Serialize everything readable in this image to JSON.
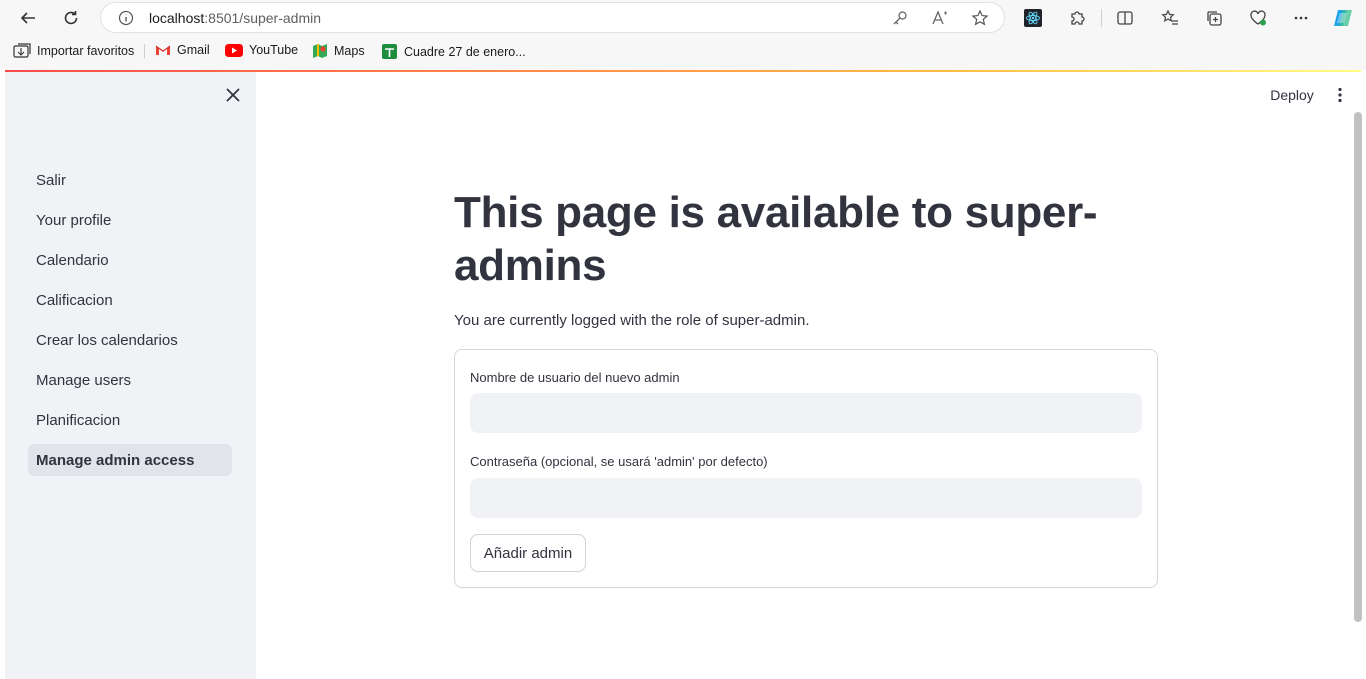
{
  "browser": {
    "url_host": "localhost",
    "url_path": ":8501/super-admin",
    "bookmarks": [
      {
        "label": "Importar favoritos",
        "icon": "import-favorites-icon"
      },
      {
        "label": "Gmail",
        "icon": "gmail-icon"
      },
      {
        "label": "YouTube",
        "icon": "youtube-icon"
      },
      {
        "label": "Maps",
        "icon": "maps-icon"
      },
      {
        "label": "Cuadre 27 de enero...",
        "icon": "sheets-icon"
      }
    ]
  },
  "sidebar": {
    "items": [
      {
        "label": "Salir",
        "active": false
      },
      {
        "label": "Your profile",
        "active": false
      },
      {
        "label": "Calendario",
        "active": false
      },
      {
        "label": "Calificacion",
        "active": false
      },
      {
        "label": "Crear los calendarios",
        "active": false
      },
      {
        "label": "Manage users",
        "active": false
      },
      {
        "label": "Planificacion",
        "active": false
      },
      {
        "label": "Manage admin access",
        "active": true
      }
    ]
  },
  "header": {
    "deploy_label": "Deploy"
  },
  "main": {
    "title": "This page is available to super-admins",
    "subtitle": "You are currently logged with the role of super-admin.",
    "form": {
      "username_label": "Nombre de usuario del nuevo admin",
      "username_value": "",
      "password_label": "Contraseña (opcional, se usará 'admin' por defecto)",
      "password_value": "",
      "submit_label": "Añadir admin"
    }
  },
  "colors": {
    "accent_red": "#ff4b4b",
    "sidebar_bg": "#f0f2f6",
    "text": "#31333f"
  }
}
